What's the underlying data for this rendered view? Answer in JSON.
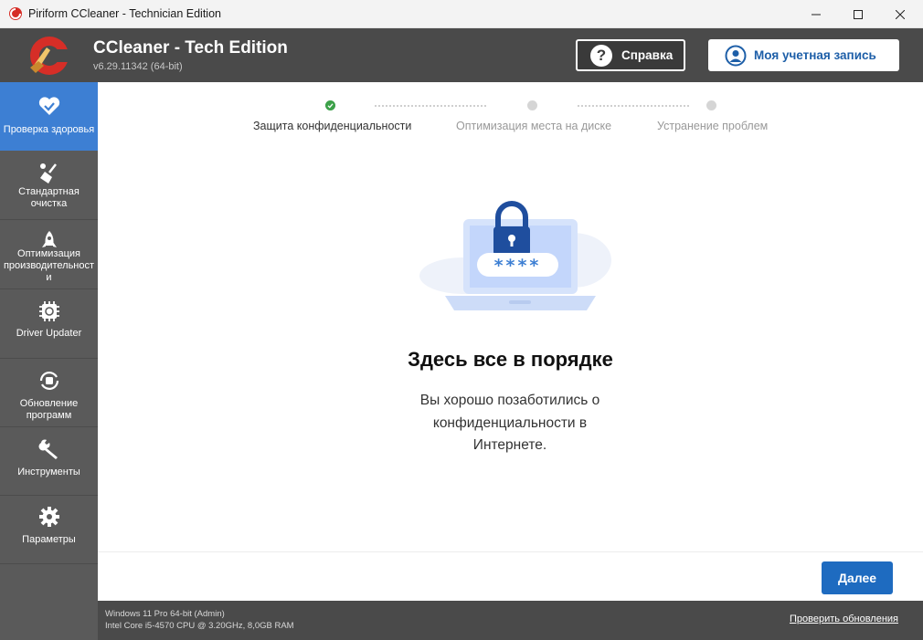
{
  "window": {
    "title": "Piriform CCleaner - Technician Edition",
    "controls": [
      "minimize-icon",
      "maximize-icon",
      "close-icon"
    ]
  },
  "header": {
    "app_name": "CCleaner - Tech Edition",
    "version": "v6.29.11342 (64-bit)",
    "help_label": "Справка",
    "account_label": "Моя учетная запись"
  },
  "sidebar": {
    "items": [
      {
        "label": "Проверка здоровья",
        "icon": "heart-icon",
        "active": true
      },
      {
        "label": "Стандартная очистка",
        "icon": "broom-icon",
        "active": false
      },
      {
        "label": "Оптимизация производительност и",
        "icon": "rocket-icon",
        "active": false
      },
      {
        "label": "Driver Updater",
        "icon": "chip-icon",
        "active": false
      },
      {
        "label": "Обновление программ",
        "icon": "refresh-icon",
        "active": false
      },
      {
        "label": "Инструменты",
        "icon": "wrench-icon",
        "active": false
      },
      {
        "label": "Параметры",
        "icon": "gear-icon",
        "active": false
      }
    ]
  },
  "steps": [
    {
      "label": "Защита конфиденциальности",
      "state": "done"
    },
    {
      "label": "Оптимизация места на диске",
      "state": "pending"
    },
    {
      "label": "Устранение проблем",
      "state": "pending"
    }
  ],
  "result": {
    "headline": "Здесь все в порядке",
    "message": "Вы хорошо позаботились о конфиденциальности в Интернете.",
    "password_mask": "****"
  },
  "actions": {
    "next_label": "Далее"
  },
  "statusbar": {
    "os": "Windows 11 Pro 64-bit (Admin)",
    "hw": "Intel Core i5-4570 CPU @ 3.20GHz, 8,0GB RAM",
    "update_link": "Проверить обновления"
  },
  "colors": {
    "accent": "#3d7fd3",
    "button": "#1e6bc0",
    "done": "#3da14a",
    "header": "#4a4a4a",
    "sidebar": "#5a5a5a"
  }
}
